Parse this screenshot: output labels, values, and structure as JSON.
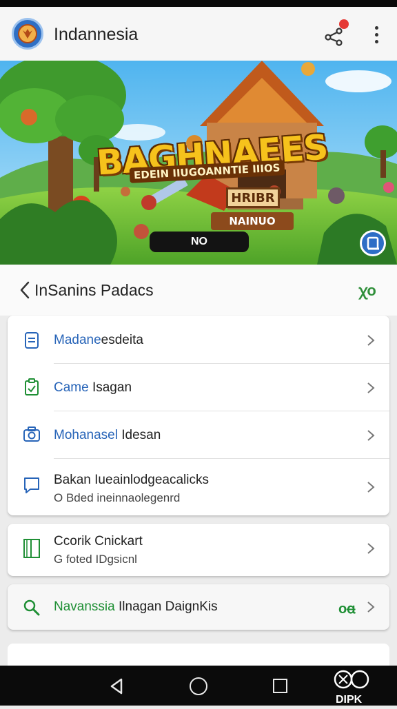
{
  "app": {
    "title": "Indannesia",
    "share_icon": "share-icon",
    "menu_icon": "more-vert-icon",
    "notification_color": "#e53935"
  },
  "banner": {
    "title": "BAGHNAEES",
    "subtitle": "EDEIN IIUGOANNTIE IIIOS",
    "sign_top": "HRIBR",
    "sign_mid": "NAINUO",
    "play_label": "NO"
  },
  "section": {
    "back_icon": "chevron-left-icon",
    "title": "InSanins Padacs",
    "action_glyph": "ꭓo",
    "action_color": "#2f8f3a"
  },
  "menu_card": {
    "items": [
      {
        "icon": "document-icon",
        "title_accent": "Madane",
        "title_rest": "esdeita",
        "accent": "#2764b8"
      },
      {
        "icon": "clipboard-icon",
        "title_accent": "Came",
        "title_rest": " Isagan",
        "accent": "#2764b8"
      },
      {
        "icon": "camera-icon",
        "title_accent": "Mohanasel",
        "title_rest": " Idesan",
        "accent": "#2764b8"
      },
      {
        "icon": "chat-bubble-icon",
        "title_accent": "",
        "title_rest": "Bakan Iueainlodgeacalicks",
        "subtitle": "O Bded ineinnaolegenrd",
        "accent": "#2764b8"
      }
    ]
  },
  "book_card": {
    "icon": "book-icon",
    "title": "Ccorik Cnickart",
    "subtitle": "G foted IDgsicnl"
  },
  "search_card": {
    "icon": "search-icon",
    "title_accent": "Navanssia",
    "title_rest": " Ilnagan DaignKis",
    "trailing": "oꬰ",
    "accent": "#1f8f35"
  },
  "navbar": {
    "back_icon": "nav-back-icon",
    "home_icon": "nav-home-icon",
    "recent_icon": "nav-recents-icon",
    "extra_icon": "assistant-icon",
    "extra_label": "DIPK"
  }
}
